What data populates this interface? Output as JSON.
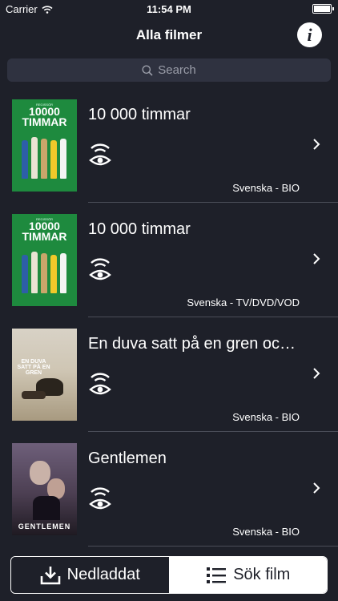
{
  "status_bar": {
    "carrier": "Carrier",
    "time": "11:54 PM"
  },
  "nav": {
    "title": "Alla filmer",
    "info_icon": "info-icon"
  },
  "search": {
    "placeholder": "Search"
  },
  "movies": [
    {
      "title": "10 000 timmar",
      "meta": "Svenska - BIO",
      "poster_text": "10000 TIMMAR",
      "poster_tagline": "REGISSÖR",
      "poster_style": "green"
    },
    {
      "title": "10 000 timmar",
      "meta": "Svenska - TV/DVD/VOD",
      "poster_text": "10000 TIMMAR",
      "poster_tagline": "REGISSÖR",
      "poster_style": "green"
    },
    {
      "title": "En duva satt på en gren oc…",
      "meta": "Svenska - BIO",
      "poster_text": "EN DUVA SATT PÅ EN GREN",
      "poster_style": "sand"
    },
    {
      "title": "Gentlemen",
      "meta": "Svenska - BIO",
      "poster_text": "GENTLEMEN",
      "poster_style": "dark"
    }
  ],
  "tabs": {
    "downloaded": "Nedladdat",
    "search_film": "Sök film"
  },
  "colors": {
    "background": "#1e2029",
    "search_field": "#2f3240",
    "separator": "#4a4d58"
  }
}
